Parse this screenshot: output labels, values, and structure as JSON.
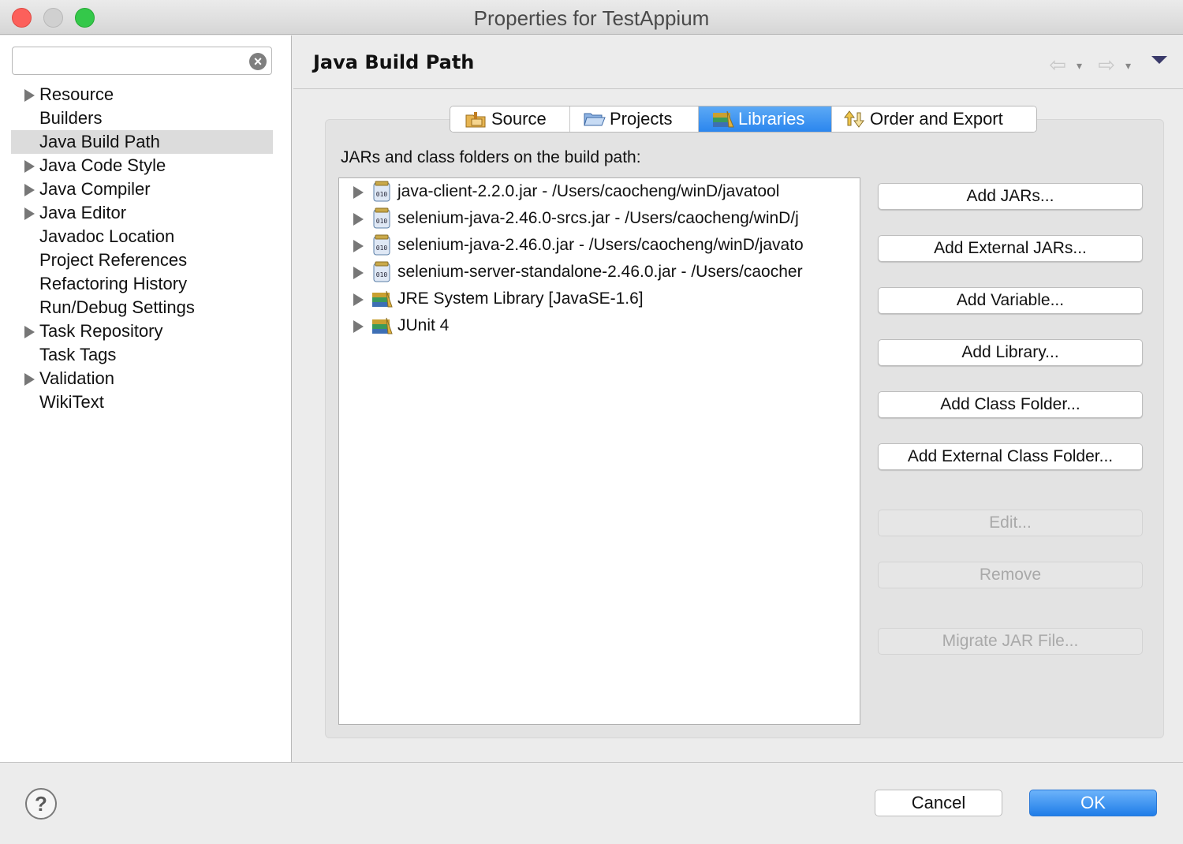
{
  "window": {
    "title": "Properties for TestAppium"
  },
  "sidebar": {
    "filter_value": "",
    "items": [
      {
        "label": "Resource",
        "expandable": true,
        "selected": false
      },
      {
        "label": "Builders",
        "expandable": false,
        "selected": false
      },
      {
        "label": "Java Build Path",
        "expandable": false,
        "selected": true
      },
      {
        "label": "Java Code Style",
        "expandable": true,
        "selected": false
      },
      {
        "label": "Java Compiler",
        "expandable": true,
        "selected": false
      },
      {
        "label": "Java Editor",
        "expandable": true,
        "selected": false
      },
      {
        "label": "Javadoc Location",
        "expandable": false,
        "selected": false
      },
      {
        "label": "Project References",
        "expandable": false,
        "selected": false
      },
      {
        "label": "Refactoring History",
        "expandable": false,
        "selected": false
      },
      {
        "label": "Run/Debug Settings",
        "expandable": false,
        "selected": false
      },
      {
        "label": "Task Repository",
        "expandable": true,
        "selected": false
      },
      {
        "label": "Task Tags",
        "expandable": false,
        "selected": false
      },
      {
        "label": "Validation",
        "expandable": true,
        "selected": false
      },
      {
        "label": "WikiText",
        "expandable": false,
        "selected": false
      }
    ]
  },
  "main": {
    "title": "Java Build Path",
    "tabs": [
      {
        "label": "Source",
        "icon": "source-folder-icon",
        "active": false
      },
      {
        "label": "Projects",
        "icon": "projects-folder-icon",
        "active": false
      },
      {
        "label": "Libraries",
        "icon": "libraries-icon",
        "active": true
      },
      {
        "label": "Order and Export",
        "icon": "order-export-icon",
        "active": false
      }
    ],
    "list_label": "JARs and class folders on the build path:",
    "libraries": [
      {
        "label": "java-client-2.2.0.jar - /Users/caocheng/winD/javatool",
        "icon": "jar-icon"
      },
      {
        "label": "selenium-java-2.46.0-srcs.jar - /Users/caocheng/winD/j",
        "icon": "jar-icon"
      },
      {
        "label": "selenium-java-2.46.0.jar - /Users/caocheng/winD/javato",
        "icon": "jar-icon"
      },
      {
        "label": "selenium-server-standalone-2.46.0.jar - /Users/caocher",
        "icon": "jar-icon"
      },
      {
        "label": "JRE System Library [JavaSE-1.6]",
        "icon": "library-icon"
      },
      {
        "label": "JUnit 4",
        "icon": "library-icon"
      }
    ],
    "buttons": [
      {
        "label": "Add JARs...",
        "enabled": true
      },
      {
        "label": "Add External JARs...",
        "enabled": true
      },
      {
        "label": "Add Variable...",
        "enabled": true
      },
      {
        "label": "Add Library...",
        "enabled": true
      },
      {
        "label": "Add Class Folder...",
        "enabled": true
      },
      {
        "label": "Add External Class Folder...",
        "enabled": true
      },
      {
        "label": "Edit...",
        "enabled": false
      },
      {
        "label": "Remove",
        "enabled": false
      },
      {
        "label": "Migrate JAR File...",
        "enabled": false
      }
    ]
  },
  "footer": {
    "cancel_label": "Cancel",
    "ok_label": "OK"
  },
  "colors": {
    "accent": "#2b86ee",
    "selection": "#dcdcdc",
    "close": "#fc605b",
    "maximize": "#34c84a"
  }
}
